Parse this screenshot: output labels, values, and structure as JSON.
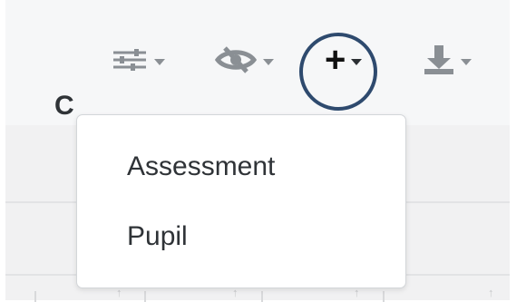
{
  "toolbar": {
    "columns_icon": "sliders-icon",
    "visibility_icon": "eye-off-icon",
    "add_glyph": "+",
    "add_icon": "plus-icon",
    "download_icon": "download-icon",
    "caret_icon": "caret-down-icon"
  },
  "table": {
    "partial_header_text": "C"
  },
  "add_menu": {
    "items": [
      {
        "label": "Assessment"
      },
      {
        "label": "Pupil"
      }
    ]
  },
  "colors": {
    "highlight_ring": "#2e4a6e",
    "toolbar_icon": "#8a8f94",
    "menu_text": "#2f3337"
  }
}
